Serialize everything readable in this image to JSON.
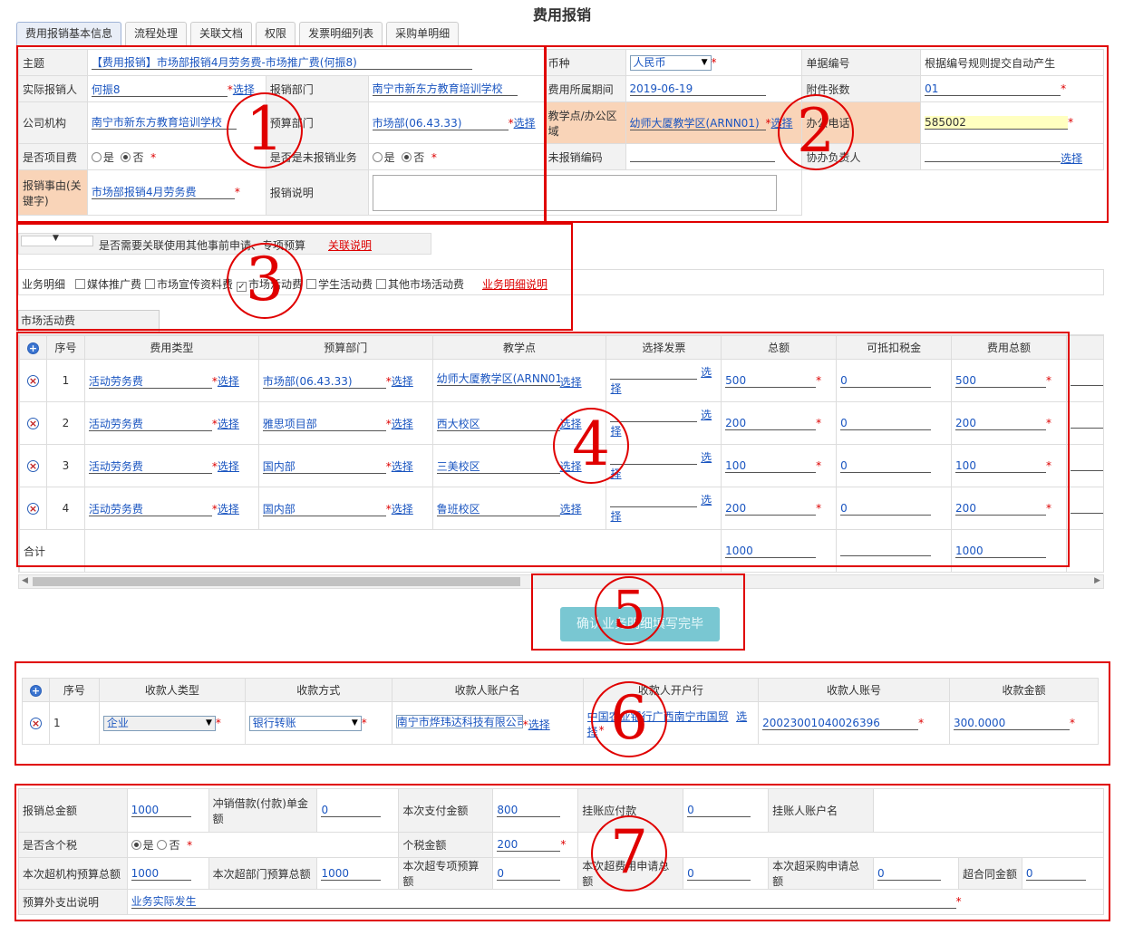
{
  "page_title": "费用报销",
  "tabs": [
    "费用报销基本信息",
    "流程处理",
    "关联文档",
    "权限",
    "发票明细列表",
    "采购单明细"
  ],
  "basic": {
    "subject_label": "主题",
    "subject": "【费用报销】市场部报销4月劳务费-市场推广费(何振8)",
    "claimant_label": "实际报销人",
    "claimant": "何振8",
    "select": "选择",
    "dept_label": "报销部门",
    "dept": "南宁市新东方教育培训学校",
    "company_label": "公司机构",
    "company": "南宁市新东方教育培训学校",
    "budget_dept_label": "预算部门",
    "budget_dept": "市场部(06.43.33)",
    "project_label": "是否项目费",
    "yes": "是",
    "no": "否",
    "unclaimed_label": "是否是未报销业务",
    "reason_label": "报销事由(关键字)",
    "reason": "市场部报销4月劳务费",
    "desc_label": "报销说明",
    "currency_label": "币种",
    "currency": "人民币",
    "docno_label": "单据编号",
    "docno": "根据编号规则提交自动产生",
    "period_label": "费用所属期间",
    "period": "2019-06-19",
    "attach_label": "附件张数",
    "attach": "01",
    "campus_label": "教学点/办公区域",
    "campus": "幼师大厦教学区(ARNN01)",
    "phone_label": "办公电话",
    "phone": "585002",
    "unclaimed_code_label": "未报销编码",
    "assist_label": "协办负责人"
  },
  "related": {
    "text": "是否需要关联使用其他事前申请、专项预算",
    "link": "关联说明",
    "biz_label": "业务明细",
    "options": [
      "媒体推广费",
      "市场宣传资料费",
      "市场活动费",
      "学生活动费",
      "其他市场活动费"
    ],
    "checked_index": 2,
    "biz_link": "业务明细说明",
    "section_tab": "市场活动费"
  },
  "detail": {
    "headers": [
      "序号",
      "费用类型",
      "预算部门",
      "教学点",
      "选择发票",
      "总额",
      "可抵扣税金",
      "费用总额"
    ],
    "rows": [
      {
        "no": "1",
        "type": "活动劳务费",
        "dept": "市场部(06.43.33)",
        "campus": "幼师大厦教学区(ARNN01",
        "total": "500",
        "tax": "0",
        "sum": "500"
      },
      {
        "no": "2",
        "type": "活动劳务费",
        "dept": "雅思项目部",
        "campus": "西大校区",
        "total": "200",
        "tax": "0",
        "sum": "200"
      },
      {
        "no": "3",
        "type": "活动劳务费",
        "dept": "国内部",
        "campus": "三美校区",
        "total": "100",
        "tax": "0",
        "sum": "100"
      },
      {
        "no": "4",
        "type": "活动劳务费",
        "dept": "国内部",
        "campus": "鲁班校区",
        "total": "200",
        "tax": "0",
        "sum": "200"
      }
    ],
    "sum_label": "合计",
    "sum_total": "1000",
    "sum_sum": "1000",
    "select_a": "选",
    "select_b": "择"
  },
  "confirm_button": "确认业务明细填写完毕",
  "payee": {
    "headers": [
      "序号",
      "收款人类型",
      "收款方式",
      "收款人账户名",
      "收款人开户行",
      "收款人账号",
      "收款金额"
    ],
    "row": {
      "no": "1",
      "type": "企业",
      "method": "银行转账",
      "name": "南宁市烨玮达科技有限公司",
      "bank": "中国农业银行广西南宁市国贸",
      "bank_sel_a": "选",
      "bank_sel_b": "择",
      "account": "20023001040026396",
      "amount": "300.0000"
    }
  },
  "summary": {
    "total_label": "报销总金额",
    "total": "1000",
    "offset_label": "冲销借款(付款)单金额",
    "offset": "0",
    "pay_label": "本次支付金额",
    "pay": "800",
    "ap_label": "挂账应付款",
    "ap": "0",
    "ap_name_label": "挂账人账户名",
    "tax_incl_label": "是否含个税",
    "yes": "是",
    "no": "否",
    "tax_label": "个税金额",
    "tax": "200",
    "over_org_label": "本次超机构预算总额",
    "over_org": "1000",
    "over_dept_label": "本次超部门预算总额",
    "over_dept": "1000",
    "over_special_label": "本次超专项预算额",
    "over_special": "0",
    "over_apply_label": "本次超费用申请总额",
    "over_apply": "0",
    "over_purchase_label": "本次超采购申请总额",
    "over_purchase": "0",
    "over_contract_label": "超合同金额",
    "over_contract": "0",
    "outside_label": "预算外支出说明",
    "outside": "业务实际发生"
  },
  "annotations": [
    "1",
    "2",
    "3",
    "4",
    "5",
    "6",
    "7"
  ]
}
